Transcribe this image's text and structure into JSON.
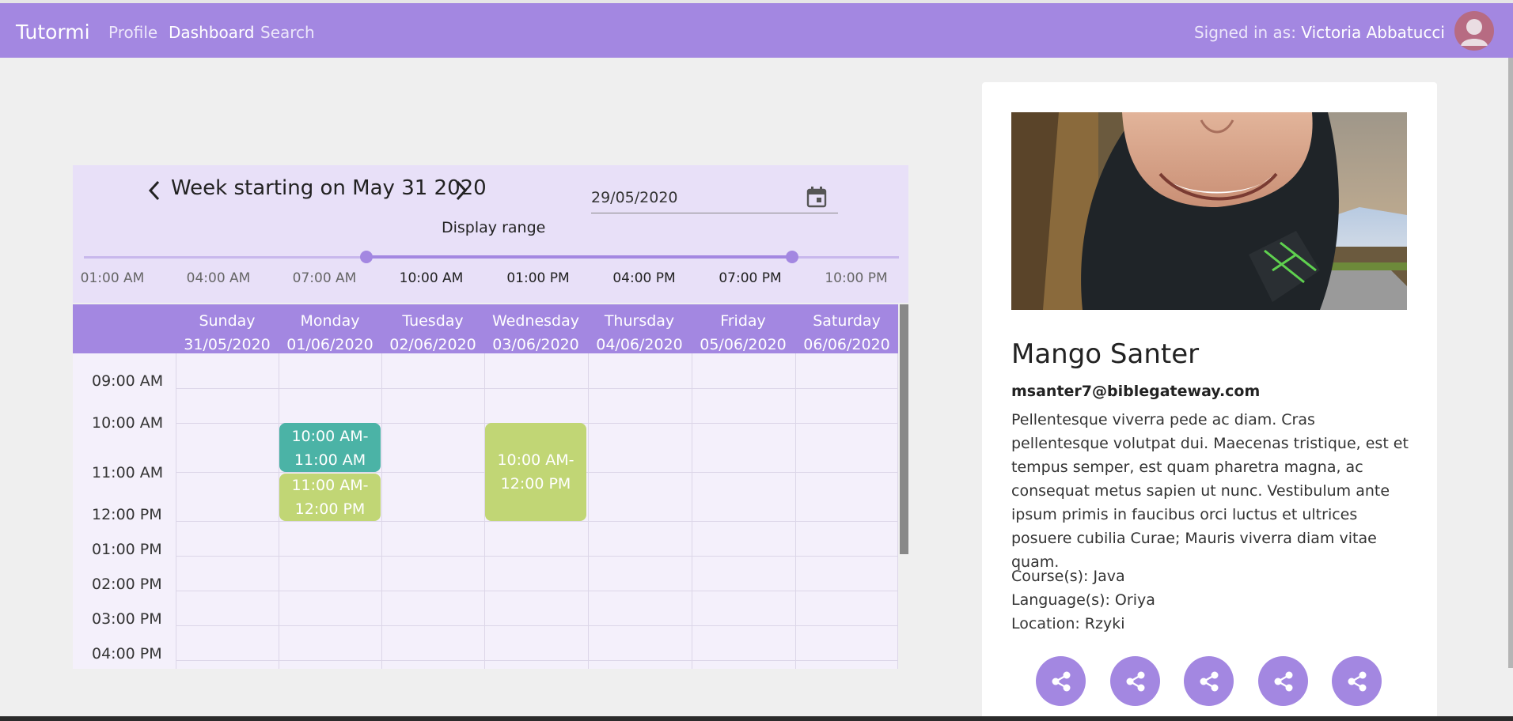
{
  "navbar": {
    "brand": "Tutormi",
    "links": [
      "Profile",
      "Dashboard",
      "Search"
    ],
    "active_link": "Dashboard",
    "signed_in_label": "Signed in as:",
    "user_name": "Victoria Abbatucci"
  },
  "calendar": {
    "week_title": "Week starting on May 31 2020",
    "date_value": "29/05/2020",
    "display_range_label": "Display range",
    "range_ticks": [
      "01:00 AM",
      "04:00 AM",
      "07:00 AM",
      "10:00 AM",
      "01:00 PM",
      "04:00 PM",
      "07:00 PM",
      "10:00 PM"
    ],
    "range_selected": [
      "09:00 AM",
      "08:00 PM"
    ],
    "days": [
      {
        "name": "Sunday",
        "date": "31/05/2020"
      },
      {
        "name": "Monday",
        "date": "01/06/2020"
      },
      {
        "name": "Tuesday",
        "date": "02/06/2020"
      },
      {
        "name": "Wednesday",
        "date": "03/06/2020"
      },
      {
        "name": "Thursday",
        "date": "04/06/2020"
      },
      {
        "name": "Friday",
        "date": "05/06/2020"
      },
      {
        "name": "Saturday",
        "date": "06/06/2020"
      }
    ],
    "time_slots": [
      "09:00 AM",
      "10:00 AM",
      "11:00 AM",
      "12:00 PM",
      "01:00 PM",
      "02:00 PM",
      "03:00 PM",
      "04:00 PM"
    ],
    "events": [
      {
        "day": "Monday",
        "line1": "10:00 AM-",
        "line2": "11:00 AM",
        "color": "#4bb3a6"
      },
      {
        "day": "Monday",
        "line1": "11:00 AM-",
        "line2": "12:00 PM",
        "color": "#c1d675"
      },
      {
        "day": "Wednesday",
        "line1": "10:00 AM-",
        "line2": "12:00 PM",
        "color": "#c1d675"
      }
    ]
  },
  "profile": {
    "name": "Mango Santer",
    "email": "msanter7@biblegateway.com",
    "bio": "Pellentesque viverra pede ac diam. Cras pellentesque volutpat dui. Maecenas tristique, est et tempus semper, est quam pharetra magna, ac consequat metus sapien ut nunc. Vestibulum ante ipsum primis in faucibus orci luctus et ultrices posuere cubilia Curae; Mauris viverra diam vitae quam.",
    "courses": "Course(s): Java",
    "languages": "Language(s): Oriya",
    "location": "Location: Rzyki",
    "share_icons": [
      "share-icon",
      "share-icon",
      "share-icon",
      "share-icon",
      "share-icon"
    ]
  },
  "colors": {
    "primary": "#a387e1",
    "teal_event": "#4bb3a6",
    "green_event": "#c1d675",
    "calendar_bg": "#e8e0f8"
  }
}
